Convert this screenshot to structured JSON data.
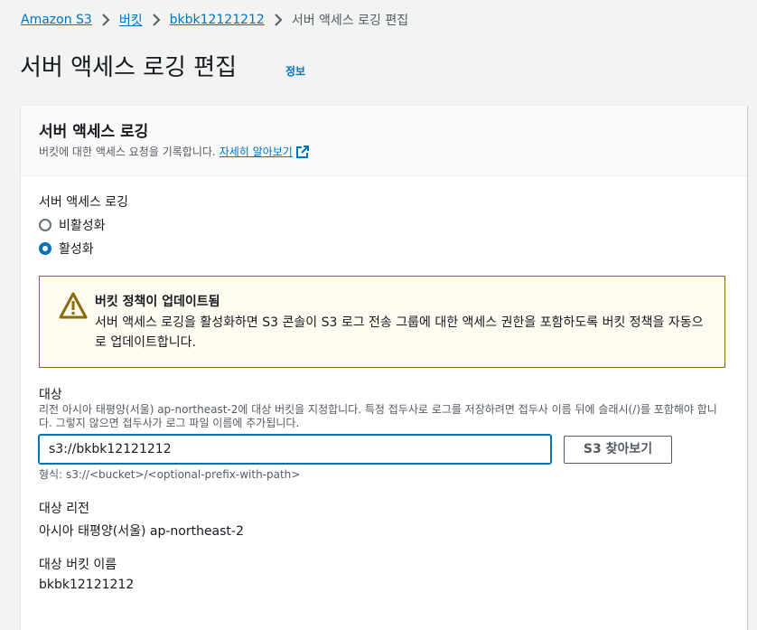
{
  "breadcrumb": {
    "items": [
      "Amazon S3",
      "버킷",
      "bkbk12121212"
    ],
    "current": "서버 액세스 로깅 편집"
  },
  "page": {
    "title": "서버 액세스 로깅 편집",
    "info_link": "정보"
  },
  "panel": {
    "title": "서버 액세스 로깅",
    "description": "버킷에 대한 액세스 요청을 기록합니다.",
    "learn_more": "자세히 알아보기"
  },
  "logging": {
    "label": "서버 액세스 로깅",
    "options": [
      {
        "label": "비활성화",
        "selected": false
      },
      {
        "label": "활성화",
        "selected": true
      }
    ]
  },
  "alert": {
    "title": "버킷 정책이 업데이트됨",
    "body": "서버 액세스 로깅을 활성화하면 S3 콘솔이 S3 로그 전송 그룹에 대한 액세스 권한을 포함하도록 버킷 정책을 자동으로 업데이트합니다.",
    "icon": "warning-icon"
  },
  "target": {
    "label": "대상",
    "description": "리전 아시아 태평양(서울) ap-northeast-2에 대상 버킷을 지정합니다. 특정 접두사로 로그를 저장하려면 접두사 이름 뒤에 슬래시(/)를 포함해야 합니다. 그렇지 않으면 접두사가 로그 파일 이름에 추가됩니다.",
    "value": "s3://bkbk12121212",
    "browse_button": "S3 찾아보기",
    "format_hint": "형식: s3://<bucket>/<optional-prefix-with-path>"
  },
  "target_region": {
    "label": "대상 리전",
    "value": "아시아 태평양(서울) ap-northeast-2"
  },
  "target_bucket": {
    "label": "대상 버킷 이름",
    "value": "bkbk12121212"
  },
  "colors": {
    "link": "#0073bb",
    "warning_border": "#8a6b05",
    "warning_bg": "#fffbf0"
  }
}
